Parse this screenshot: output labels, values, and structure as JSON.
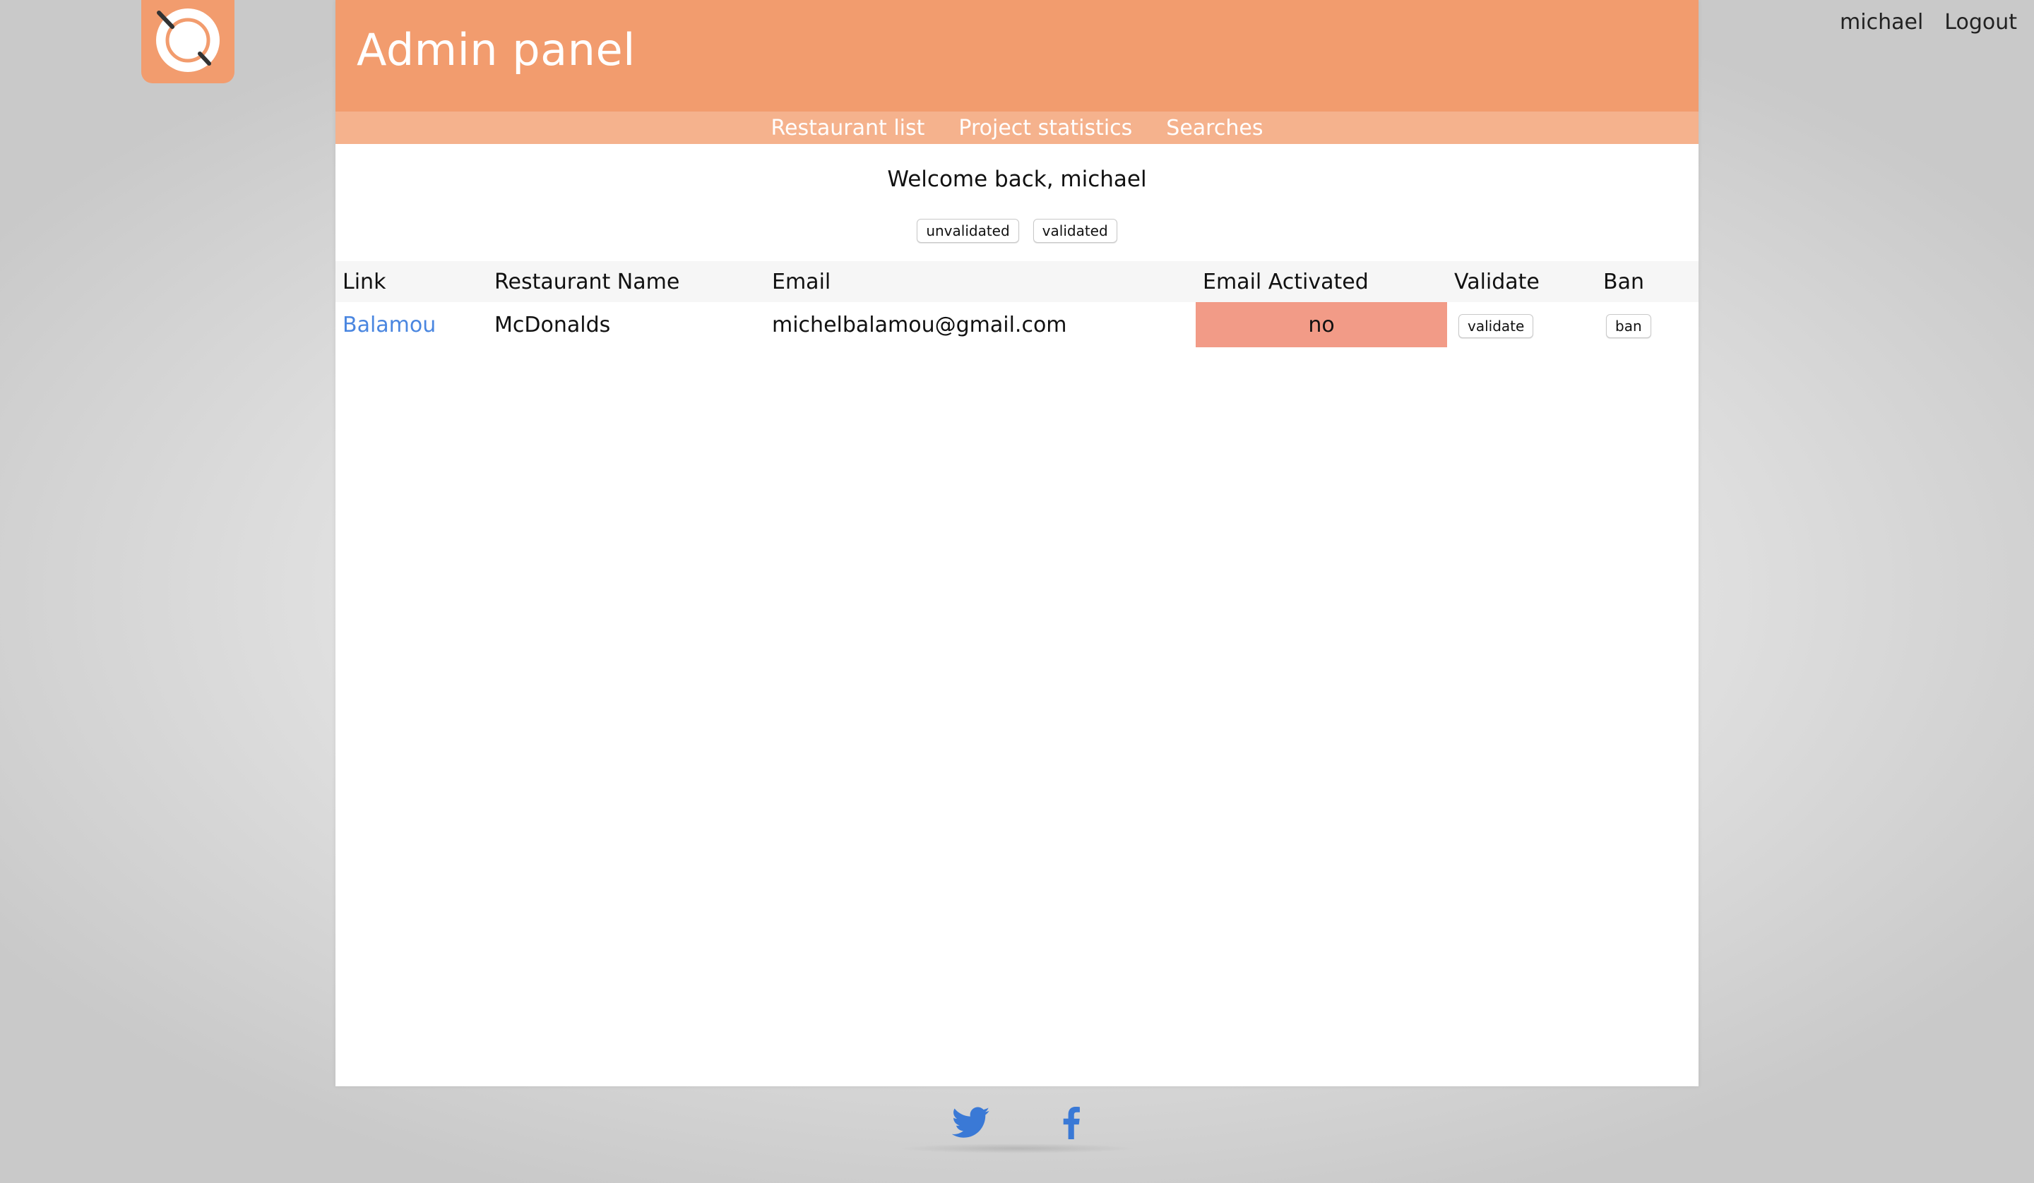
{
  "header": {
    "title": "Admin panel"
  },
  "user": {
    "name": "michael",
    "logout_label": "Logout"
  },
  "nav": {
    "items": [
      {
        "label": "Restaurant list"
      },
      {
        "label": "Project statistics"
      },
      {
        "label": "Searches"
      }
    ]
  },
  "welcome_text": "Welcome back, michael",
  "filters": {
    "unvalidated_label": "unvalidated",
    "validated_label": "validated"
  },
  "table": {
    "headers": [
      "Link",
      "Restaurant Name",
      "Email",
      "Email Activated",
      "Validate",
      "Ban"
    ],
    "rows": [
      {
        "link": "Balamou",
        "name": "McDonalds",
        "email": "michelbalamou@gmail.com",
        "email_activated": "no",
        "validate_label": "validate",
        "ban_label": "ban"
      }
    ]
  },
  "footer": {
    "icons": [
      "twitter-icon",
      "facebook-icon"
    ]
  },
  "colors": {
    "brand": "#f29c6e",
    "nav": "#f5b28d",
    "inactive_cell": "#f29b87",
    "link": "#4a86e0",
    "social": "#3a79d6"
  }
}
